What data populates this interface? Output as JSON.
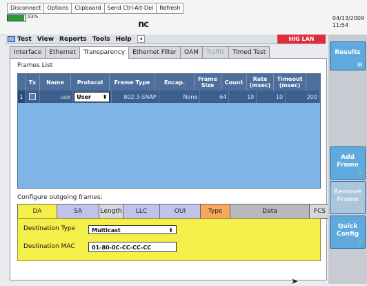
{
  "toolbar": {
    "buttons": [
      "Disconnect",
      "Options",
      "Clipboard",
      "Send Ctrl-Alt-Del",
      "Refresh"
    ],
    "battery_label": "93%",
    "battery_level": 0.93,
    "logo_text": "nc",
    "date": "04/13/2009",
    "time": "11:54"
  },
  "menubar": {
    "items": [
      "Test",
      "View",
      "Reports",
      "Tools",
      "Help"
    ],
    "status_badge": "HIG LAN",
    "status_color": "#e02d3e"
  },
  "tabs": [
    {
      "label": "Interface",
      "active": false,
      "disabled": false
    },
    {
      "label": "Ethernet",
      "active": false,
      "disabled": false
    },
    {
      "label": "Transparency",
      "active": true,
      "disabled": false
    },
    {
      "label": "Ethernet Filter",
      "active": false,
      "disabled": false
    },
    {
      "label": "OAM",
      "active": false,
      "disabled": false
    },
    {
      "label": "Traffic",
      "active": false,
      "disabled": true
    },
    {
      "label": "Timed Test",
      "active": false,
      "disabled": false
    }
  ],
  "frames": {
    "section_label": "Frames List",
    "columns": [
      "",
      "Tx",
      "Name",
      "Protocol",
      "Frame Type",
      "Encap.",
      "Frame Size",
      "Count",
      "Rate (msec)",
      "Timeout (msec)"
    ],
    "rows": [
      {
        "index": "1",
        "tx": true,
        "name": "use",
        "protocol": "User",
        "frame_type": "802.3-SNAP",
        "encap": "None",
        "frame_size": "64",
        "count": "10",
        "rate": "10",
        "timeout": "200"
      }
    ]
  },
  "configure": {
    "section_label": "Configure outgoing frames:",
    "fields": [
      {
        "label": "DA",
        "color": "#f4ef4a"
      },
      {
        "label": "SA",
        "color": "#bfc3ea"
      },
      {
        "label": "Length",
        "color": "#d5d7da"
      },
      {
        "label": "LLC",
        "color": "#bfc3ea"
      },
      {
        "label": "OUI",
        "color": "#bfc3ea"
      },
      {
        "label": "Type",
        "color": "#f7a85d"
      },
      {
        "label": "Data",
        "color": "#b7b9be"
      },
      {
        "label": "FCS",
        "color": "#d5d7da"
      }
    ],
    "destination_type_label": "Destination Type",
    "destination_type_value": "Multicast",
    "destination_mac_label": "Destination MAC",
    "destination_mac_value": "01-80-0C-CC-CC-CC"
  },
  "softkeys": [
    {
      "label": "Results",
      "disabled": false
    },
    {
      "label": "Add Frame",
      "disabled": false
    },
    {
      "label": "Remove Frame",
      "disabled": true
    },
    {
      "label": "Quick Config",
      "disabled": false
    }
  ]
}
